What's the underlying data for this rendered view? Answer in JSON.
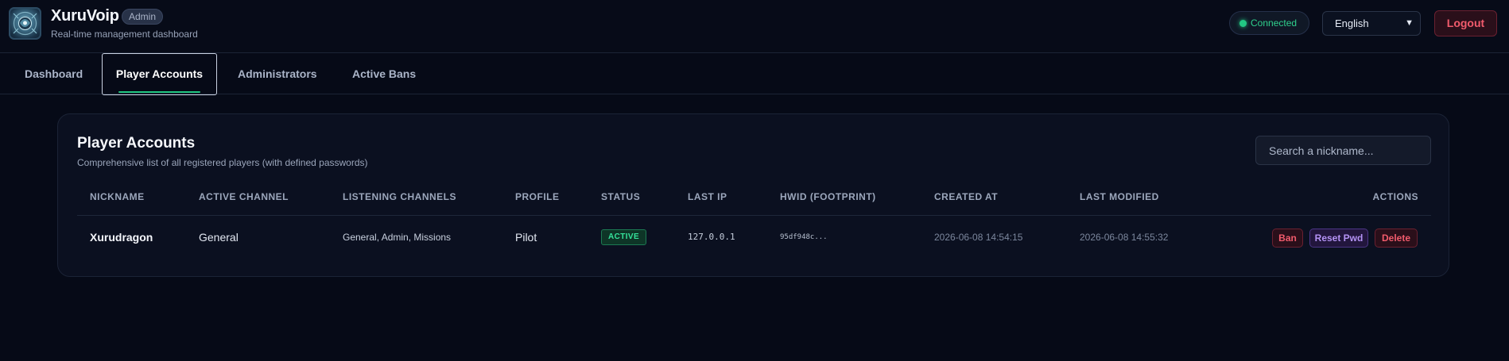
{
  "app": {
    "title": "XuruVoip",
    "badge": "Admin",
    "subtitle": "Real-time management dashboard"
  },
  "header": {
    "connection_status": "Connected",
    "language": "English",
    "logout_label": "Logout"
  },
  "tabs": [
    {
      "label": "Dashboard",
      "active": false
    },
    {
      "label": "Player Accounts",
      "active": true
    },
    {
      "label": "Administrators",
      "active": false
    },
    {
      "label": "Active Bans",
      "active": false
    }
  ],
  "card": {
    "title": "Player Accounts",
    "subtitle": "Comprehensive list of all registered players (with defined passwords)",
    "search_placeholder": "Search a nickname..."
  },
  "table": {
    "columns": [
      "Nickname",
      "Active Channel",
      "Listening Channels",
      "Profile",
      "Status",
      "Last IP",
      "HWID (Footprint)",
      "Created At",
      "Last Modified",
      "Actions"
    ],
    "rows": [
      {
        "nickname": "Xurudragon",
        "active_channel": "General",
        "listening_channels": "General, Admin, Missions",
        "profile": "Pilot",
        "status": "ACTIVE",
        "last_ip": "127.0.0.1",
        "hwid": "95df948c...",
        "created_at": "2026-06-08 14:54:15",
        "last_modified": "2026-06-08 14:55:32",
        "actions": [
          "Ban",
          "Reset Pwd",
          "Delete"
        ]
      }
    ]
  },
  "colors": {
    "background": "#060a17",
    "accent_green": "#22c783",
    "danger": "#f15b6c",
    "purple": "#b493f5"
  }
}
